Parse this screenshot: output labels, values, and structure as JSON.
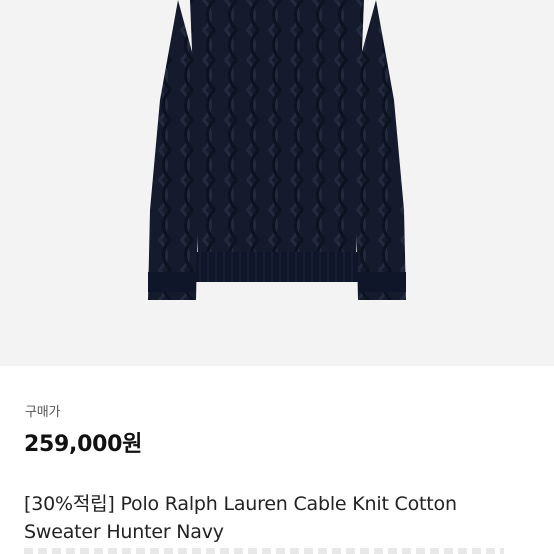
{
  "product": {
    "image_icon": "navy-cable-knit-sweater",
    "price_label": "구매가",
    "price": "259,000원",
    "title_line1": "[30%적립] Polo Ralph Lauren Cable Knit Cotton",
    "title_line2": "Sweater Hunter Navy"
  },
  "colors": {
    "image_background": "#f3f3f3",
    "sweater": "#141a2b"
  }
}
